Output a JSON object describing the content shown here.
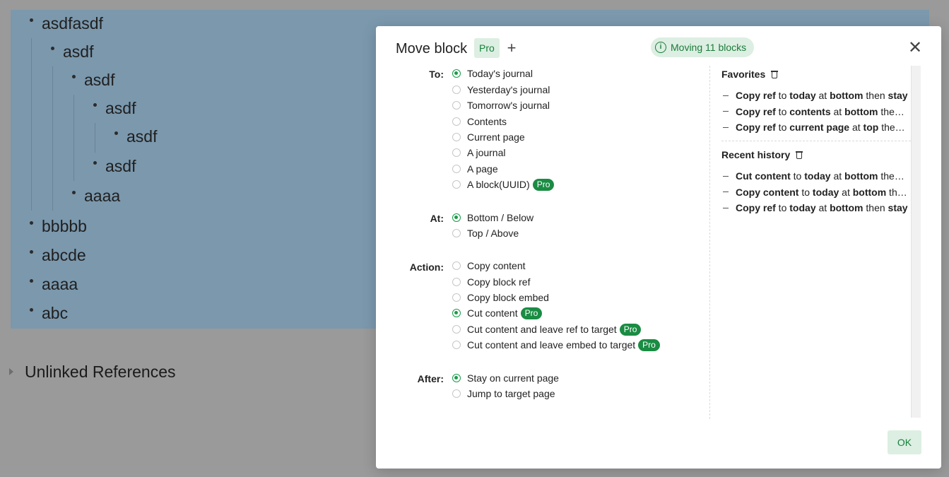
{
  "outline": {
    "items": [
      {
        "text": "asdfasdf"
      },
      {
        "text": "asdf"
      },
      {
        "text": "asdf"
      },
      {
        "text": "asdf"
      },
      {
        "text": "asdf"
      },
      {
        "text": "asdf"
      },
      {
        "text": "aaaa"
      },
      {
        "text": "bbbbb"
      },
      {
        "text": "abcde"
      },
      {
        "text": "aaaa"
      },
      {
        "text": "abc"
      }
    ],
    "unlinked_references": "Unlinked References"
  },
  "dialog": {
    "title": "Move block",
    "pro_label": "Pro",
    "plus": "+",
    "moving_label": "Moving 11 blocks",
    "info_glyph": "i",
    "close_glyph": "✕",
    "ok_label": "OK",
    "to": {
      "label": "To:",
      "options": [
        {
          "label": "Today's journal",
          "checked": true
        },
        {
          "label": "Yesterday's journal",
          "checked": false
        },
        {
          "label": "Tomorrow's journal",
          "checked": false
        },
        {
          "label": "Contents",
          "checked": false
        },
        {
          "label": "Current page",
          "checked": false
        },
        {
          "label": "A journal",
          "checked": false
        },
        {
          "label": "A page",
          "checked": false
        },
        {
          "label": "A block(UUID)",
          "checked": false,
          "badge": "Pro"
        }
      ]
    },
    "at": {
      "label": "At:",
      "options": [
        {
          "label": "Bottom / Below",
          "checked": true
        },
        {
          "label": "Top / Above",
          "checked": false
        }
      ]
    },
    "action": {
      "label": "Action:",
      "options": [
        {
          "label": "Copy content",
          "checked": false
        },
        {
          "label": "Copy block ref",
          "checked": false
        },
        {
          "label": "Copy block embed",
          "checked": false
        },
        {
          "label": "Cut content",
          "checked": true,
          "badge": "Pro"
        },
        {
          "label": "Cut content and leave ref to target",
          "checked": false,
          "badge": "Pro"
        },
        {
          "label": "Cut content and leave embed to target",
          "checked": false,
          "badge": "Pro"
        }
      ]
    },
    "after": {
      "label": "After:",
      "options": [
        {
          "label": "Stay on current page",
          "checked": true
        },
        {
          "label": "Jump to target page",
          "checked": false
        }
      ]
    },
    "favorites": {
      "title": "Favorites",
      "items": [
        [
          {
            "t": "Copy ref",
            "b": true
          },
          {
            "t": " to ",
            "b": false
          },
          {
            "t": "today",
            "b": true
          },
          {
            "t": " at ",
            "b": false
          },
          {
            "t": "bottom",
            "b": true
          },
          {
            "t": " then ",
            "b": false
          },
          {
            "t": "stay",
            "b": true
          }
        ],
        [
          {
            "t": "Copy ref",
            "b": true
          },
          {
            "t": " to ",
            "b": false
          },
          {
            "t": "contents",
            "b": true
          },
          {
            "t": " at ",
            "b": false
          },
          {
            "t": "bottom",
            "b": true
          },
          {
            "t": " then stay",
            "b": false
          }
        ],
        [
          {
            "t": "Copy ref",
            "b": true
          },
          {
            "t": " to ",
            "b": false
          },
          {
            "t": "current page",
            "b": true
          },
          {
            "t": " at ",
            "b": false
          },
          {
            "t": "top",
            "b": true
          },
          {
            "t": " then stay",
            "b": false
          }
        ]
      ]
    },
    "recent": {
      "title": "Recent history",
      "items": [
        [
          {
            "t": "Cut content",
            "b": true
          },
          {
            "t": " to ",
            "b": false
          },
          {
            "t": "today",
            "b": true
          },
          {
            "t": " at ",
            "b": false
          },
          {
            "t": "bottom",
            "b": true
          },
          {
            "t": " then stay",
            "b": false
          }
        ],
        [
          {
            "t": "Copy content",
            "b": true
          },
          {
            "t": " to ",
            "b": false
          },
          {
            "t": "today",
            "b": true
          },
          {
            "t": " at ",
            "b": false
          },
          {
            "t": "bottom",
            "b": true
          },
          {
            "t": " then stay",
            "b": false
          }
        ],
        [
          {
            "t": "Copy ref",
            "b": true
          },
          {
            "t": " to ",
            "b": false
          },
          {
            "t": "today",
            "b": true
          },
          {
            "t": " at ",
            "b": false
          },
          {
            "t": "bottom",
            "b": true
          },
          {
            "t": " then ",
            "b": false
          },
          {
            "t": "stay",
            "b": true
          }
        ]
      ]
    }
  }
}
